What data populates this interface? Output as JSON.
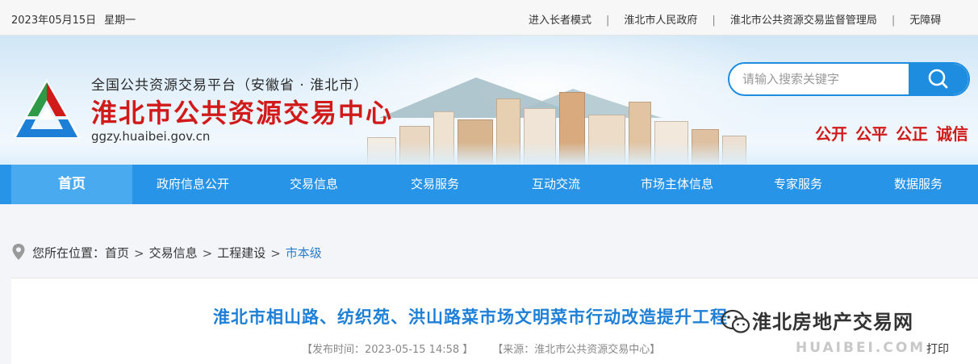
{
  "topbar": {
    "date": "2023年05月15日",
    "weekday": "星期一",
    "links": [
      "进入长者模式",
      "淮北市人民政府",
      "淮北市公共资源交易监督管理局",
      "无障碍"
    ]
  },
  "header": {
    "platform": "全国公共资源交易平台（安徽省 · 淮北市）",
    "site_name": "淮北市公共资源交易中心",
    "domain": "ggzy.huaibei.gov.cn",
    "search_placeholder": "请输入搜索关键字",
    "slogan": [
      "公开",
      "公平",
      "公正",
      "诚信"
    ],
    "brand_red": "#d11b1b",
    "accent_blue": "#1e8de0"
  },
  "nav": {
    "items": [
      "首页",
      "政府信息公开",
      "交易信息",
      "交易服务",
      "互动交流",
      "市场主体信息",
      "专家服务",
      "数据服务"
    ],
    "active_index": 0
  },
  "breadcrumb": {
    "label": "您所在位置：",
    "items": [
      "首页",
      "交易信息",
      "工程建设",
      "市本级"
    ]
  },
  "article": {
    "title": "淮北市相山路、纺织苑、洪山路菜市场文明菜市行动改造提升工程",
    "publish_time": "【发布时间：2023-05-15 14:58 】",
    "source": "【来源：淮北市公共资源交易中心】",
    "print_label": "打印"
  },
  "watermark": {
    "text": "淮北房地产交易网",
    "sub": "HUAIBEI.COM"
  }
}
